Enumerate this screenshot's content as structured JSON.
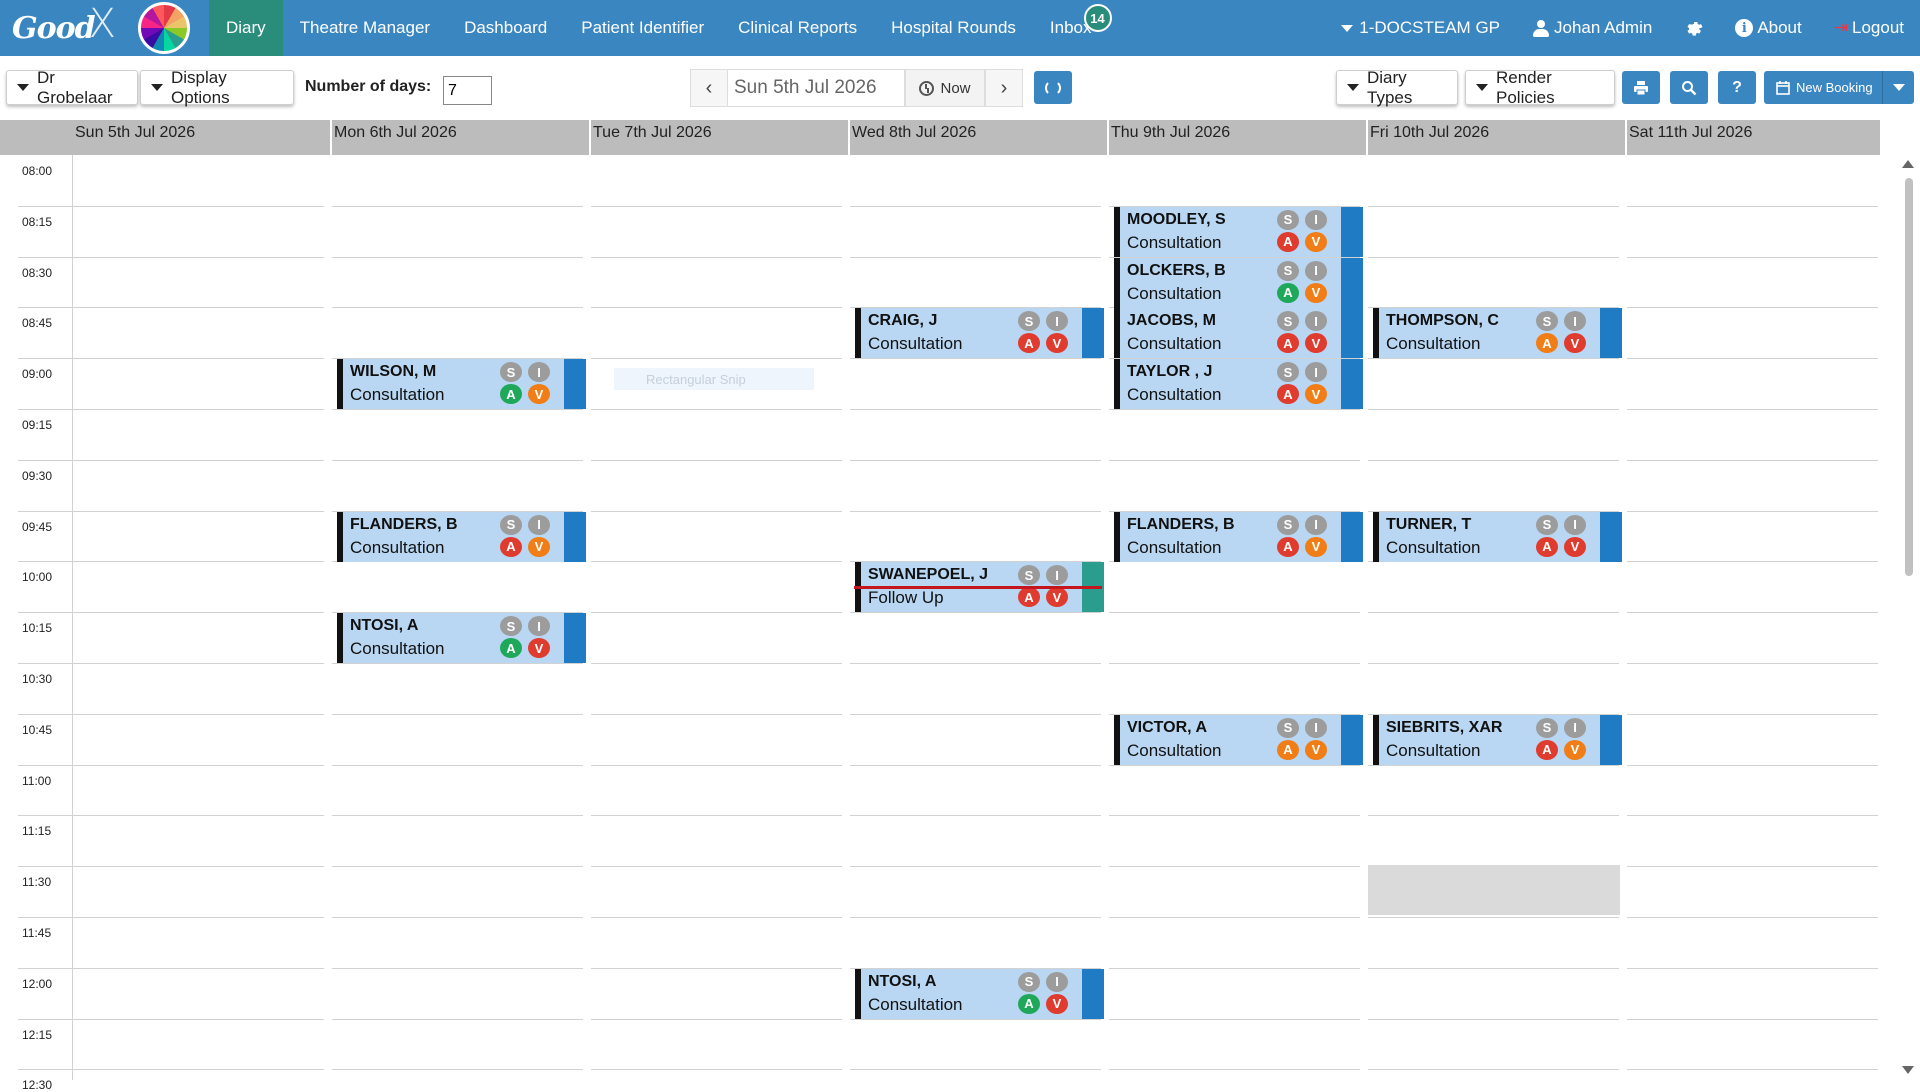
{
  "app": {
    "logo_text": "Good",
    "logo_mark": "X"
  },
  "nav": {
    "items": [
      "Diary",
      "Theatre Manager",
      "Dashboard",
      "Patient Identifier",
      "Clinical Reports",
      "Hospital Rounds",
      "Inbox"
    ],
    "active": "Diary",
    "inbox_count": "14",
    "practice": "1-DOCSTEAM GP",
    "user": "Johan Admin",
    "about": "About",
    "logout": "Logout"
  },
  "toolbar": {
    "doctor": "Dr Grobelaar",
    "display_options": "Display Options",
    "days_label": "Number of days:",
    "days_value": "7",
    "date": "Sun 5th Jul 2026",
    "now": "Now",
    "diary_types": "Diary Types",
    "render_policies": "Render Policies",
    "new_booking": "New Booking",
    "help": "?"
  },
  "colors": {
    "nav_bg": "#3a86c1",
    "active_nav": "#2a8d7c",
    "appt_bg": "#b9d7f2",
    "appt_stripe": "#1f7bc4",
    "now_line": "#c4161c"
  },
  "days": [
    "Sun 5th Jul 2026",
    "Mon 6th Jul 2026",
    "Tue 7th Jul 2026",
    "Wed 8th Jul 2026",
    "Thu 9th Jul 2026",
    "Fri 10th Jul 2026",
    "Sat 11th Jul 2026"
  ],
  "times": [
    "08:00",
    "08:15",
    "08:30",
    "08:45",
    "09:00",
    "09:15",
    "09:30",
    "09:45",
    "10:00",
    "10:15",
    "10:30",
    "10:45",
    "11:00",
    "11:15",
    "11:30",
    "11:45",
    "12:00",
    "12:15",
    "12:30"
  ],
  "appointments": [
    {
      "day": 4,
      "slot": 1,
      "name": "MOODLEY, S",
      "type": "Consultation",
      "a": "red",
      "v": "orange",
      "stripe": "blue"
    },
    {
      "day": 4,
      "slot": 2,
      "name": "OLCKERS, B",
      "type": "Consultation",
      "a": "green",
      "v": "orange",
      "stripe": "blue"
    },
    {
      "day": 3,
      "slot": 3,
      "name": "CRAIG, J",
      "type": "Consultation",
      "a": "red",
      "v": "red",
      "stripe": "blue"
    },
    {
      "day": 4,
      "slot": 3,
      "name": "JACOBS, M",
      "type": "Consultation",
      "a": "red",
      "v": "red",
      "stripe": "blue"
    },
    {
      "day": 5,
      "slot": 3,
      "name": "THOMPSON, C",
      "type": "Consultation",
      "a": "orange",
      "v": "red",
      "stripe": "blue"
    },
    {
      "day": 1,
      "slot": 4,
      "name": "WILSON, M",
      "type": "Consultation",
      "a": "green",
      "v": "orange",
      "stripe": "blue"
    },
    {
      "day": 4,
      "slot": 4,
      "name": "TAYLOR , J",
      "type": "Consultation",
      "a": "red",
      "v": "orange",
      "stripe": "blue"
    },
    {
      "day": 1,
      "slot": 7,
      "name": "FLANDERS, B",
      "type": "Consultation",
      "a": "red",
      "v": "orange",
      "stripe": "blue"
    },
    {
      "day": 4,
      "slot": 7,
      "name": "FLANDERS, B",
      "type": "Consultation",
      "a": "red",
      "v": "orange",
      "stripe": "blue"
    },
    {
      "day": 5,
      "slot": 7,
      "name": "TURNER, T",
      "type": "Consultation",
      "a": "red",
      "v": "red",
      "stripe": "blue"
    },
    {
      "day": 3,
      "slot": 8,
      "name": "SWANEPOEL, J",
      "type": "Follow Up",
      "a": "red",
      "v": "red",
      "stripe": "green"
    },
    {
      "day": 1,
      "slot": 9,
      "name": "NTOSI, A",
      "type": "Consultation",
      "a": "green",
      "v": "red",
      "stripe": "blue"
    },
    {
      "day": 4,
      "slot": 11,
      "name": "VICTOR, A",
      "type": "Consultation",
      "a": "orange",
      "v": "orange",
      "stripe": "blue"
    },
    {
      "day": 5,
      "slot": 11,
      "name": "SIEBRITS, XAR",
      "type": "Consultation",
      "a": "red",
      "v": "orange",
      "stripe": "blue"
    },
    {
      "day": 3,
      "slot": 16,
      "name": "NTOSI, A",
      "type": "Consultation",
      "a": "green",
      "v": "red",
      "stripe": "blue"
    }
  ],
  "badge_letters": {
    "s": "S",
    "i": "I",
    "a": "A",
    "v": "V"
  },
  "snip_label": "Rectangular Snip"
}
